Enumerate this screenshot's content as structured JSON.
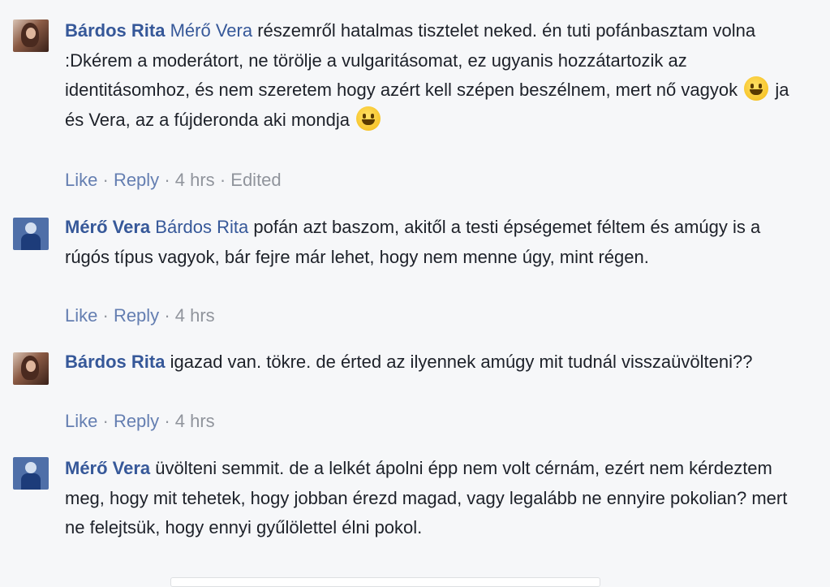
{
  "comments": [
    {
      "author": "Bárdos Rita",
      "mention": "Mérő Vera",
      "text": " részemről hatalmas tisztelet neked. én tuti pofánbasztam volna :Dkérem a moderátort, ne törölje a vulgaritásomat, ez ugyanis hozzátartozik az identitásomhoz, és nem szeretem hogy azért kell szépen beszélnem, mert nő vagyok",
      "text2": " ja és Vera, az a fújderonda aki mondja",
      "actions": {
        "like": "Like",
        "reply": "Reply",
        "time": "4 hrs",
        "edited": "Edited"
      }
    },
    {
      "author": "Mérő Vera",
      "mention": "Bárdos Rita",
      "text": " pofán azt baszom, akitől a testi épségemet féltem és amúgy is a rúgós típus vagyok, bár fejre már lehet, hogy nem menne úgy, mint régen.",
      "actions": {
        "like": "Like",
        "reply": "Reply",
        "time": "4 hrs"
      }
    },
    {
      "author": "Bárdos Rita",
      "text": " igazad van. tökre. de érted az ilyennek amúgy mit tudnál visszaüvölteni??",
      "actions": {
        "like": "Like",
        "reply": "Reply",
        "time": "4 hrs"
      }
    },
    {
      "author": "Mérő Vera",
      "text": " üvölteni semmit. de a lelkét ápolni épp nem volt cérnám, ezért nem kérdeztem meg, hogy mit tehetek, hogy jobban érezd magad, vagy legalább ne ennyire pokolian? mert ne felejtsük, hogy ennyi gyűlölettel élni pokol."
    }
  ],
  "icons": {
    "emoji": "smiley-emoji-icon"
  },
  "colors": {
    "link": "#365899",
    "muted": "#90949c",
    "background": "#f6f7f9"
  }
}
